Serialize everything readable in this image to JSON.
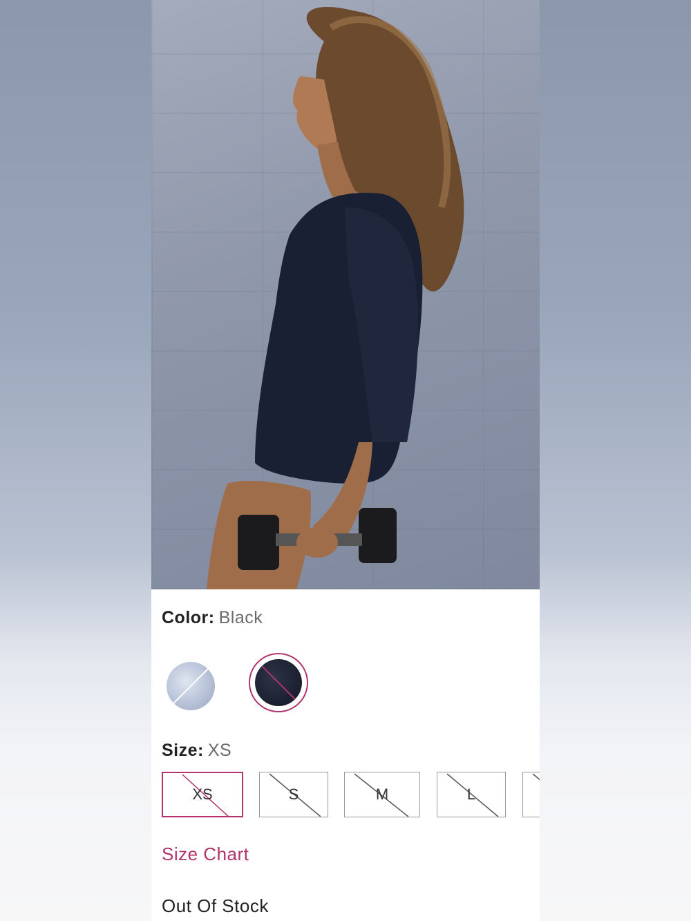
{
  "product": {
    "image_alt": "Product photo",
    "color_label": "Color:",
    "color_value": "Black",
    "size_label": "Size:",
    "size_value": "XS",
    "swatches": [
      {
        "name": "Light Blue",
        "color": "#b7c2d8",
        "available": false,
        "selected": false
      },
      {
        "name": "Black",
        "color": "#1b2030",
        "available": false,
        "selected": true
      }
    ],
    "sizes": [
      {
        "label": "XS",
        "available": false,
        "selected": true
      },
      {
        "label": "S",
        "available": false,
        "selected": false
      },
      {
        "label": "M",
        "available": false,
        "selected": false
      },
      {
        "label": "L",
        "available": false,
        "selected": false
      },
      {
        "label": "",
        "available": false,
        "selected": false
      }
    ],
    "size_chart_link": "Size Chart",
    "stock_status": "Out Of Stock"
  },
  "colors": {
    "accent": "#b0336b",
    "text": "#222222",
    "muted": "#6b6b6b",
    "border": "#9a9a9a"
  }
}
